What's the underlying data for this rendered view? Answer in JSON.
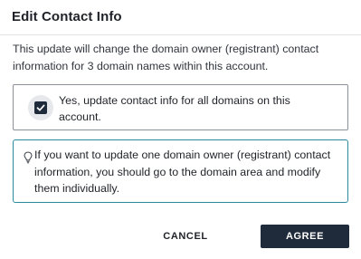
{
  "dialog": {
    "title": "Edit Contact Info",
    "description": "This update will change the domain owner (registrant) contact information for 3 domain names within this account.",
    "checkbox": {
      "label": "Yes, update contact info for all domains on this account.",
      "checked": true
    },
    "info": {
      "icon": "lightbulb-icon",
      "text": "If you want to update one domain owner (registrant) contact information, you should go to the domain area and modify them individually."
    },
    "buttons": {
      "cancel_label": "CANCEL",
      "agree_label": "AGREE"
    }
  },
  "colors": {
    "primary_button": "#1f2a3a",
    "info_border": "#2a8a9c",
    "checkbox_border": "#8c9099",
    "divider": "#e2e4e8"
  }
}
